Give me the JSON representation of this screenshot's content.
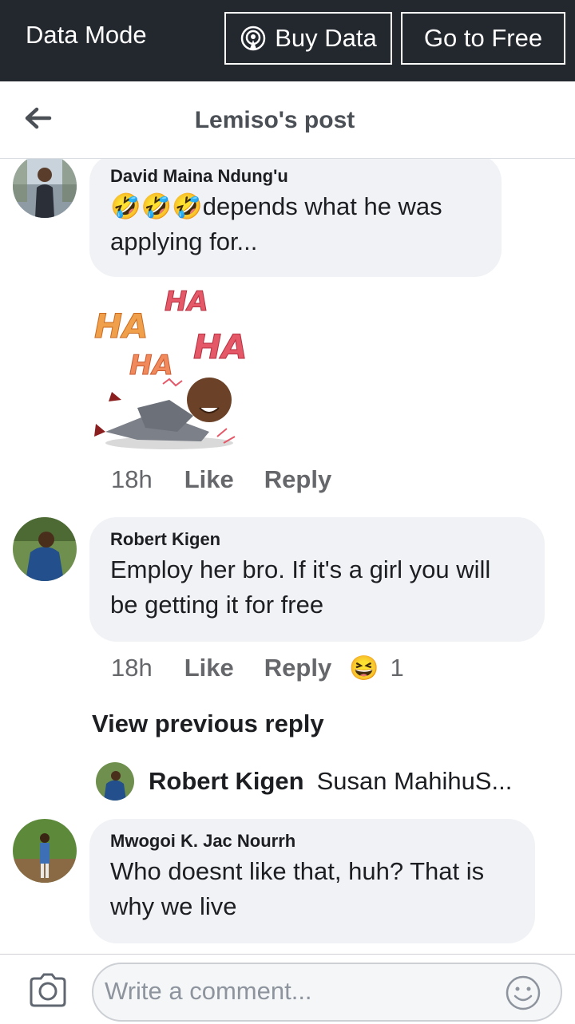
{
  "top_bar": {
    "mode_label": "Data Mode",
    "buy_data_label": "Buy Data",
    "go_free_label": "Go to Free"
  },
  "header": {
    "title": "Lemiso's post",
    "back_icon": "back-arrow-icon"
  },
  "comments": [
    {
      "author": "David Maina Ndung'u",
      "emojis": "🤣🤣🤣",
      "text": "depends what he was applying for...",
      "sticker_text": [
        "HA",
        "HA",
        "HA",
        "HA"
      ],
      "time": "18h",
      "like": "Like",
      "reply": "Reply"
    },
    {
      "author": "Robert Kigen",
      "text": "Employ her bro. If it's a girl you will be getting it for free",
      "time": "18h",
      "like": "Like",
      "reply": "Reply",
      "reaction": "😆",
      "reaction_count": "1"
    },
    {
      "author": "Mwogoi K. Jac Nourrh",
      "text": "Who doesnt like that, huh? That is why we live"
    }
  ],
  "view_previous": "View previous reply",
  "reply_preview": {
    "author": "Robert Kigen",
    "text": "Susan MahihuS..."
  },
  "composer": {
    "placeholder": "Write a comment...",
    "camera_icon": "camera-icon",
    "emoji_icon": "smiley-icon"
  },
  "colors": {
    "top_bar": "#23272e",
    "bubble": "#f0f2f5",
    "meta": "#65676b"
  }
}
